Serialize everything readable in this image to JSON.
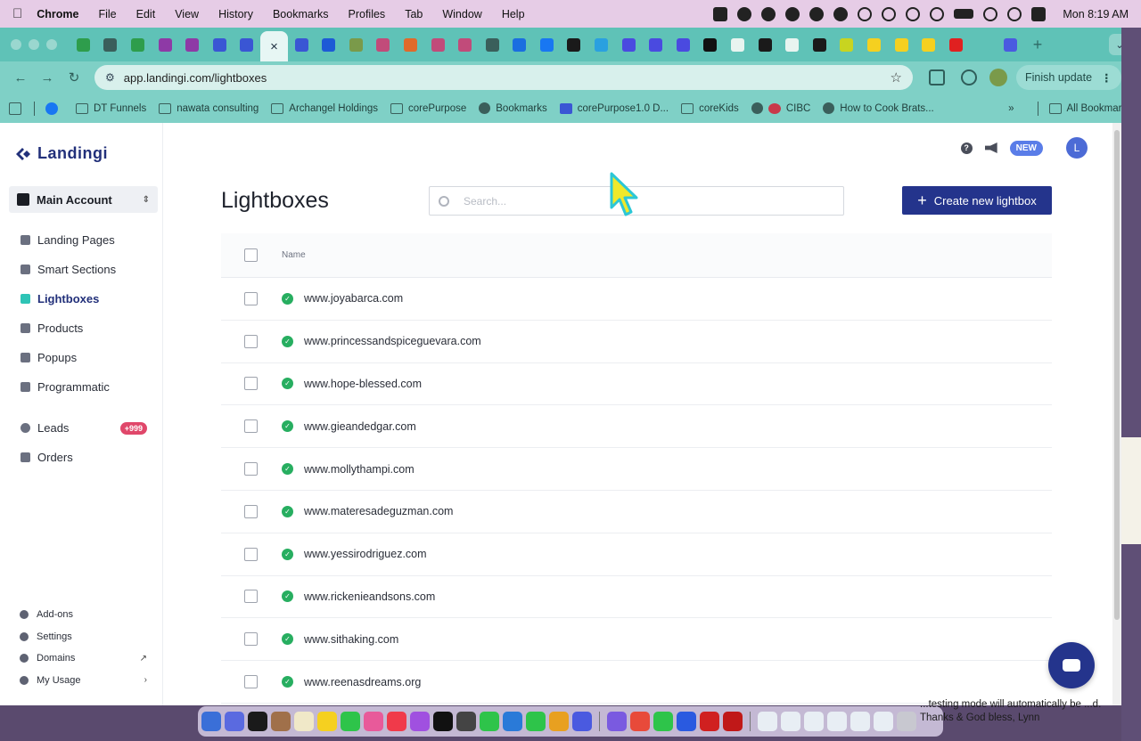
{
  "menubar": {
    "app_name": "Chrome",
    "items": [
      "File",
      "Edit",
      "View",
      "History",
      "Bookmarks",
      "Profiles",
      "Tab",
      "Window",
      "Help"
    ],
    "clock": "Mon  8:19 AM"
  },
  "browser": {
    "url": "app.landingi.com/lightboxes",
    "finish_update_label": "Finish update",
    "bookmarks": [
      {
        "label": "DT Funnels",
        "icon": "folder-icon"
      },
      {
        "label": "nawata consulting",
        "icon": "folder-icon"
      },
      {
        "label": "Archangel Holdings",
        "icon": "folder-icon"
      },
      {
        "label": "corePurpose",
        "icon": "folder-icon"
      },
      {
        "label": "Bookmarks",
        "icon": "star-icon"
      },
      {
        "label": "corePurpose1.0 D...",
        "icon": "app-icon"
      },
      {
        "label": "coreKids",
        "icon": "folder-icon"
      },
      {
        "label": "CIBC",
        "icon": "cibc-icon"
      },
      {
        "label": "How to Cook Brats...",
        "icon": "web-icon"
      }
    ],
    "all_bookmarks_label": "All Bookmarks"
  },
  "sidebar": {
    "logo": "Landingi",
    "account": "Main Account",
    "items": [
      {
        "label": "Landing Pages",
        "active": false
      },
      {
        "label": "Smart Sections",
        "active": false
      },
      {
        "label": "Lightboxes",
        "active": true
      },
      {
        "label": "Products",
        "active": false
      },
      {
        "label": "Popups",
        "active": false
      },
      {
        "label": "Programmatic",
        "active": false
      },
      {
        "label": "Leads",
        "badge": "+999"
      },
      {
        "label": "Orders"
      }
    ],
    "bottom_items": [
      "Add-ons",
      "Settings",
      "Domains",
      "My Usage"
    ]
  },
  "header": {
    "new_badge": "NEW",
    "avatar_initial": "L"
  },
  "page": {
    "title": "Lightboxes",
    "search_placeholder": "Search...",
    "create_button": "Create new lightbox",
    "column_name": "Name",
    "rows": [
      "www.joyabarca.com",
      "www.princessandspiceguevara.com",
      "www.hope-blessed.com",
      "www.gieandedgar.com",
      "www.mollythampi.com",
      "www.materesadeguzman.com",
      "www.yessirodriguez.com",
      "www.rickenieandsons.com",
      "www.sithaking.com",
      "www.reenasdreams.org"
    ]
  },
  "notification": {
    "text": "...testing mode will automatically be ...d. Thanks & God bless, Lynn"
  },
  "colors": {
    "brand": "#24348c",
    "active_indicator": "#2ec4b6",
    "status_ok": "#27ae60",
    "leads_badge": "#e0476a"
  }
}
